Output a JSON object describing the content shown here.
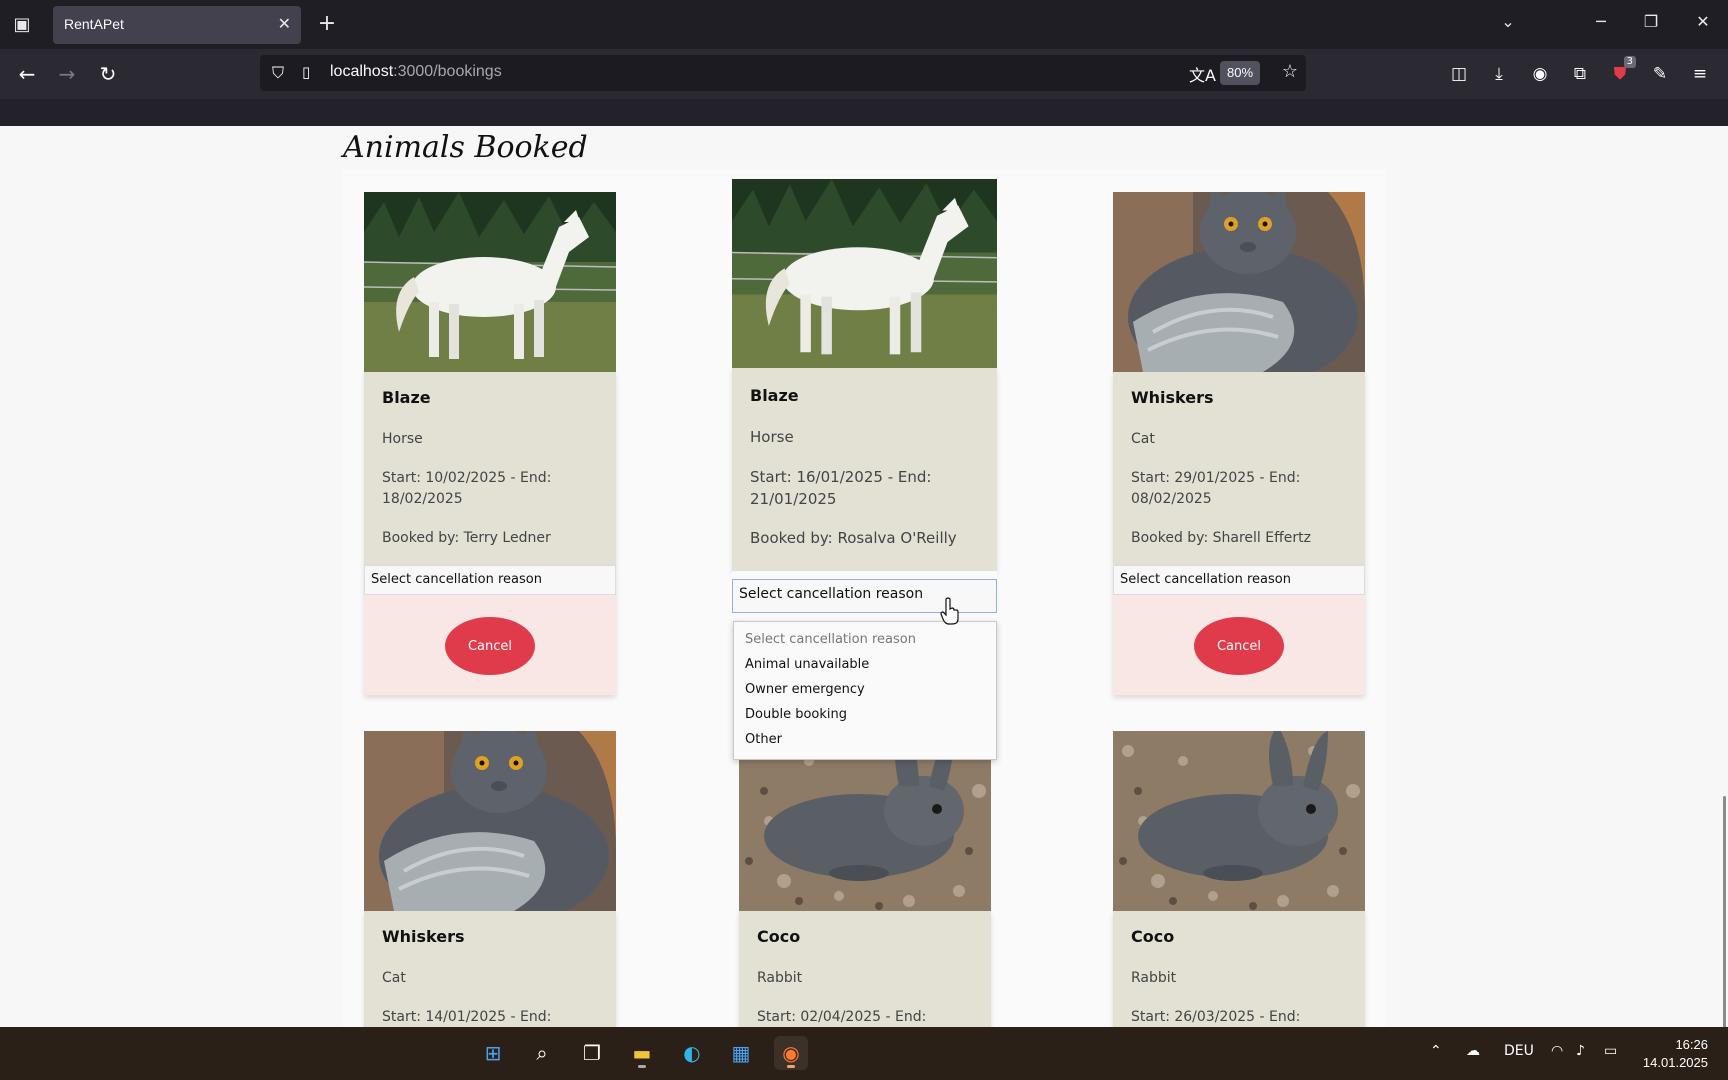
{
  "browser": {
    "tab_title": "RentAPet",
    "url_host": "localhost",
    "url_path": ":3000/bookings",
    "zoom": "80%",
    "extension_badge": "3"
  },
  "page": {
    "title": "Animals Booked"
  },
  "cards": [
    {
      "name": "Blaze",
      "species": "Horse",
      "dates": "Start: 10/02/2025 - End: 18/02/2025",
      "booked_by": "Booked by: Terry Ledner",
      "select": "Select cancellation reason",
      "cancel": "Cancel",
      "photo": "white-horse"
    },
    {
      "name": "Blaze",
      "species": "Horse",
      "dates": "Start: 16/01/2025 - End: 21/01/2025",
      "booked_by": "Booked by: Rosalva O'Reilly",
      "select": "Select cancellation reason",
      "cancel": "Cancel",
      "photo": "white-horse"
    },
    {
      "name": "Whiskers",
      "species": "Cat",
      "dates": "Start: 29/01/2025 - End: 08/02/2025",
      "booked_by": "Booked by: Sharell Effertz",
      "select": "Select cancellation reason",
      "cancel": "Cancel",
      "photo": "grey-cat"
    },
    {
      "name": "Whiskers",
      "species": "Cat",
      "dates": "Start: 14/01/2025 - End:",
      "photo": "grey-cat"
    },
    {
      "name": "Coco",
      "species": "Rabbit",
      "dates": "Start: 02/04/2025 - End:",
      "photo": "grey-rabbit"
    },
    {
      "name": "Coco",
      "species": "Rabbit",
      "dates": "Start: 26/03/2025 - End:",
      "photo": "grey-rabbit"
    }
  ],
  "dropdown": {
    "options": [
      "Select cancellation reason",
      "Animal unavailable",
      "Owner emergency",
      "Double booking",
      "Other"
    ]
  },
  "taskbar": {
    "language": "DEU",
    "time": "16:26",
    "date": "14.01.2025"
  }
}
